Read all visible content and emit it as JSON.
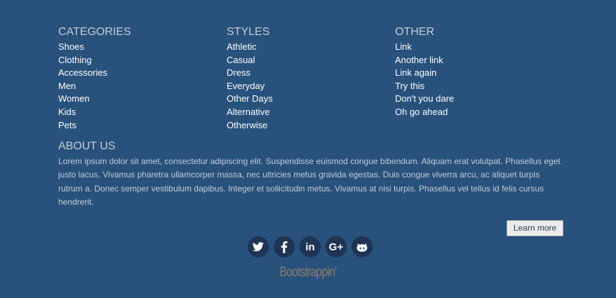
{
  "columns": [
    {
      "title": "CATEGORIES",
      "links": [
        "Shoes",
        "Clothing",
        "Accessories",
        "Men",
        "Women",
        "Kids",
        "Pets"
      ]
    },
    {
      "title": "STYLES",
      "links": [
        "Athletic",
        "Casual",
        "Dress",
        "Everyday",
        "Other Days",
        "Alternative",
        "Otherwise"
      ]
    },
    {
      "title": "OTHER",
      "links": [
        "Link",
        "Another link",
        "Link again",
        "Try this",
        "Don't you dare",
        "Oh go ahead"
      ]
    }
  ],
  "about": {
    "title": "ABOUT US",
    "text": "Lorem ipsum dolor sit amet, consectetur adipiscing elit. Suspendisse euismod congue bibendum. Aliquam erat volutpat. Phasellus eget justo lacus. Vivamus pharetra ullamcorper massa, nec ultricies metus gravida egestas. Duis congue viverra arcu, ac aliquet turpis rutrum a. Donec semper vestibulum dapibus. Integer et sollicitudin metus. Vivamus at nisi turpis. Phasellus vel tellus id felis cursus hendrerit.",
    "button_label": "Learn more"
  },
  "social": {
    "icons": [
      "twitter-icon",
      "facebook-icon",
      "linkedin-icon",
      "google-plus-icon",
      "github-icon"
    ],
    "linkedin_text": "in",
    "google_text": "G+"
  },
  "brand": "Bootstrappin'",
  "colors": {
    "background": "#28517c",
    "heading": "#c5ccd6",
    "link": "#ffffff",
    "social_circle": "#1e3454",
    "brand": "#8c7d6c"
  }
}
